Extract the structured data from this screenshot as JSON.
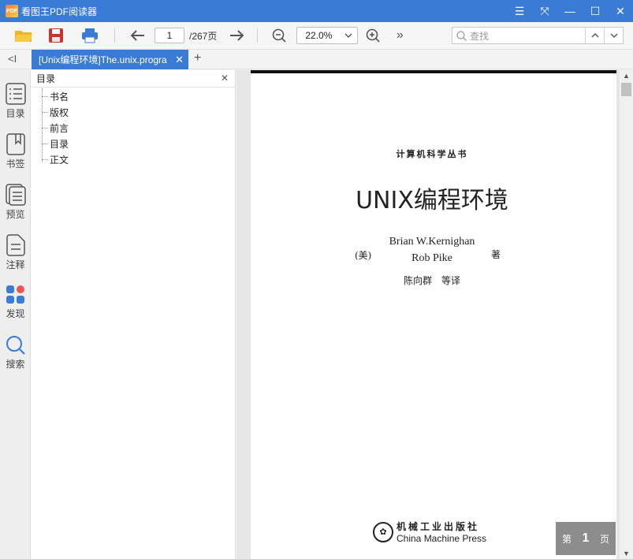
{
  "app": {
    "title": "看图王PDF阅读器",
    "logo_text": "PDF"
  },
  "window_controls": {
    "menu": "☰",
    "fullscreen": "⤧",
    "minimize": "—",
    "maximize": "☐",
    "close": "✕"
  },
  "toolbar": {
    "page_current": "1",
    "page_total": "/267页",
    "zoom": "22.0%",
    "more": "»",
    "search_placeholder": "查找"
  },
  "tabs": {
    "collapse": "<I",
    "active_label": "[Unix编程环境]The.unix.progra",
    "close": "✕",
    "add": "+"
  },
  "sidebar": {
    "items": [
      {
        "label": "目录",
        "icon": "toc-icon"
      },
      {
        "label": "书签",
        "icon": "bookmark-icon"
      },
      {
        "label": "预览",
        "icon": "preview-icon"
      },
      {
        "label": "注释",
        "icon": "annotation-icon"
      },
      {
        "label": "发现",
        "icon": "discover-icon"
      },
      {
        "label": "搜索",
        "icon": "search-icon"
      }
    ]
  },
  "outline": {
    "title": "目录",
    "close": "✕",
    "items": [
      "书名",
      "版权",
      "前言",
      "目录",
      "正文"
    ]
  },
  "document": {
    "series": "计算机科学丛书",
    "title": "UNIX编程环境",
    "author_prefix": "(美)",
    "author1": "Brian W.Kernighan",
    "author2": "Rob Pike",
    "author_suffix": "著",
    "translators": "陈向群　等译",
    "publisher_cn": "机械工业出版社",
    "publisher_en": "China Machine Press"
  },
  "page_indicator": {
    "prefix": "第",
    "number": "1",
    "suffix": "页"
  },
  "colors": {
    "accent": "#3a7bd5",
    "discover_red": "#f05454",
    "discover_blue": "#3a7bd5"
  }
}
